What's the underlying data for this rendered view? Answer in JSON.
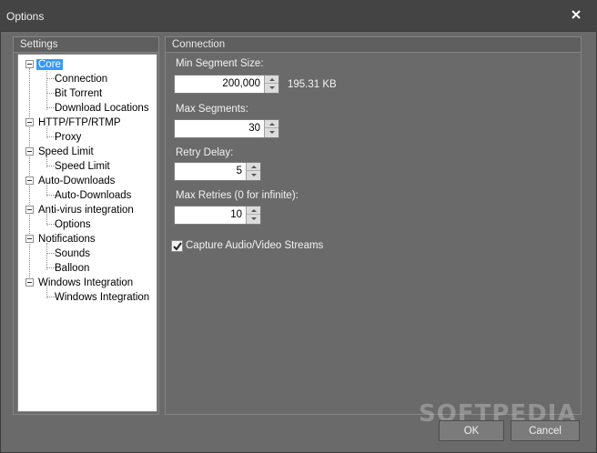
{
  "window": {
    "title": "Options"
  },
  "settings": {
    "group_title": "Settings",
    "tree": [
      {
        "label": "Core",
        "selected": true,
        "children": [
          "Connection",
          "Bit Torrent",
          "Download Locations"
        ]
      },
      {
        "label": "HTTP/FTP/RTMP",
        "children": [
          "Proxy"
        ]
      },
      {
        "label": "Speed Limit",
        "children": [
          "Speed Limit"
        ]
      },
      {
        "label": "Auto-Downloads",
        "children": [
          "Auto-Downloads"
        ]
      },
      {
        "label": "Anti-virus integration",
        "children": [
          "Options"
        ]
      },
      {
        "label": "Notifications",
        "children": [
          "Sounds",
          "Balloon"
        ]
      },
      {
        "label": "Windows Integration",
        "children": [
          "Windows Integration"
        ]
      }
    ]
  },
  "connection": {
    "group_title": "Connection",
    "min_segment_label": "Min Segment Size:",
    "min_segment_value": "200,000",
    "min_segment_hint": "195.31 KB",
    "max_segments_label": "Max Segments:",
    "max_segments_value": "30",
    "retry_delay_label": "Retry Delay:",
    "retry_delay_value": "5",
    "max_retries_label": "Max Retries (0 for infinite):",
    "max_retries_value": "10",
    "capture_label": "Capture Audio/Video Streams",
    "capture_checked": true
  },
  "footer": {
    "ok_label": "OK",
    "cancel_label": "Cancel"
  },
  "watermark": "SOFTPEDIA"
}
